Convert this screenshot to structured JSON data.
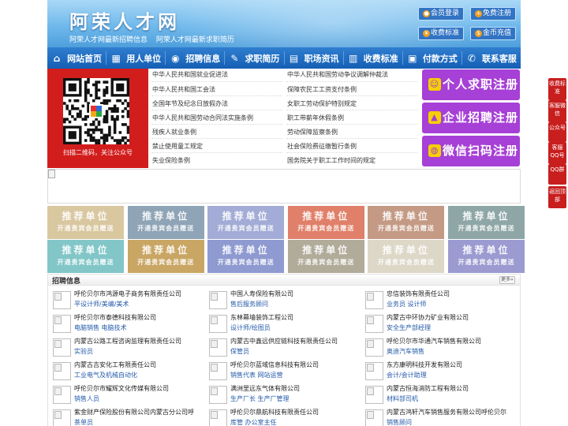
{
  "header": {
    "site_title": "阿荣人才网",
    "link_jobs": "阿荣人才网最新招聘信息",
    "link_resumes": "阿荣人才网最新求职简历",
    "buttons": {
      "member_login": "会员登录",
      "free_register": "免费注册",
      "fee_standard": "收费标准",
      "coin_recharge": "金币充值"
    }
  },
  "nav": {
    "items": [
      {
        "label": "网站首页",
        "icon": "home-icon"
      },
      {
        "label": "用人单位",
        "icon": "building-icon"
      },
      {
        "label": "招聘信息",
        "icon": "megaphone-icon"
      },
      {
        "label": "求职简历",
        "icon": "resume-icon"
      },
      {
        "label": "职场资讯",
        "icon": "news-icon"
      },
      {
        "label": "收费标准",
        "icon": "chart-icon"
      },
      {
        "label": "付款方式",
        "icon": "payment-icon"
      },
      {
        "label": "联系客服",
        "icon": "phone-icon"
      }
    ]
  },
  "qr": {
    "caption": "扫描二维码，关注公众号"
  },
  "laws": {
    "left": [
      "中华人民共和国就业促进法",
      "中华人民共和国工会法",
      "全国年节及纪念日放假办法",
      "中华人民共和国劳动合同法实施条例",
      "残疾人就业条例",
      "禁止使用童工规定",
      "失业保险条例"
    ],
    "right": [
      "中华人民共和国劳动争议调解仲裁法",
      "保障农民工工资支付条例",
      "女职工劳动保护特别规定",
      "职工带薪年休假条例",
      "劳动保障监察条例",
      "社会保险费征缴暂行条例",
      "国务院关于职工工作时间的规定"
    ]
  },
  "cta": {
    "personal": "个人求职注册",
    "company": "企业招聘注册",
    "wechat": "微信扫码注册"
  },
  "recommend": {
    "title": "推荐单位",
    "subtitle": "开通贵宾会员赠送",
    "row1_colors": [
      "#d9c7a0",
      "#8fa4b6",
      "#a3acd6",
      "#e0806a",
      "#c49a85",
      "#8ea6a6"
    ],
    "row2_colors": [
      "#82c6c8",
      "#c9a664",
      "#8e9ad0",
      "#b1ab9a",
      "#dcd7c7",
      "#9b9bd1"
    ]
  },
  "jobs": {
    "title": "招聘信息",
    "more": "更多»",
    "columns": [
      [
        {
          "company": "呼伦贝尔市鸿源电子商务有限责任公司",
          "positions": "平设计师/美编/美术"
        },
        {
          "company": "呼伦贝尔市泰德科技有限公司",
          "positions": "电脑销售  电脑技术"
        },
        {
          "company": "内蒙古公路工程咨询监理有限责任公司",
          "positions": "实验员"
        },
        {
          "company": "内蒙古吉安化工有限责任公司",
          "positions": "工业电气及机械自动化"
        },
        {
          "company": "呼伦贝尔市耀辉文化传媒有限公司",
          "positions": "销售人员"
        },
        {
          "company": "紫金财产保险股份有限公司内蒙古分公司呼",
          "positions": "茶单员"
        }
      ],
      [
        {
          "company": "中国人寿保险有限公司",
          "positions": "售后服务顾问"
        },
        {
          "company": "东林幕墙装饰工程公司",
          "positions": "设计师/绘图员"
        },
        {
          "company": "内蒙古中鑫远供应链科技有限责任公司",
          "positions": "保管员"
        },
        {
          "company": "呼伦贝尔蓝域信息科技有限公司",
          "positions": "销售代表  网站运营"
        },
        {
          "company": "满洲里远东气体有限公司",
          "positions": "生产厂长  生产厂管理"
        },
        {
          "company": "呼伦贝尔鼎航科技有限责任公司",
          "positions": "库管  办公室主任"
        }
      ],
      [
        {
          "company": "忠信装饰有限责任公司",
          "positions": "业务员  设计师"
        },
        {
          "company": "内蒙古中环协力矿业有限公司",
          "positions": "安全生产部经理"
        },
        {
          "company": "呼伦贝尔市华通汽车销售有限公司",
          "positions": "奥迪汽车销售"
        },
        {
          "company": "东方康明科技开发有限公司",
          "positions": "会计/会计助理"
        },
        {
          "company": "内蒙古恒海消防工程有限公司",
          "positions": "材料部司机"
        },
        {
          "company": "内蒙古鸿轩汽车销售服务有限公司呼伦贝尔",
          "positions": "销售顾问"
        }
      ]
    ]
  },
  "side": {
    "fee": "收费标准",
    "wechat_service": "客服微信",
    "official_account": "公众号",
    "service_qq": "客服QQ号",
    "qq_group": "QQ群",
    "back_top": "返回顶部"
  }
}
